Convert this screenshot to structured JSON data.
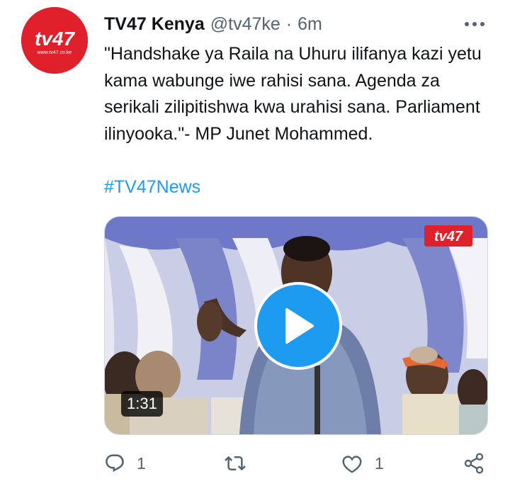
{
  "tweet": {
    "author_name": "TV47 Kenya",
    "handle": "@tv47ke",
    "separator": "·",
    "time": "6m",
    "avatar_logo_text": "tv47",
    "avatar_site_text": "www.tv47.co.ke",
    "text": "\"Handshake ya Raila na Uhuru ilifanya kazi yetu kama wabunge iwe rahisi sana. Agenda za serikali zilipitishwa kwa urahisi sana. Parliament ilinyooka.\"- MP Junet Mohammed.",
    "hashtag": "#TV47News"
  },
  "video": {
    "duration": "1:31",
    "watermark_text": "tv47"
  },
  "actions": {
    "reply_count": "1",
    "retweet_count": "",
    "like_count": "1"
  },
  "icons": [
    "more-icon",
    "reply-icon",
    "retweet-icon",
    "like-icon",
    "share-icon",
    "play-icon"
  ],
  "colors": {
    "brand_red": "#e0202a",
    "accent_blue": "#1d9bf0",
    "secondary_text": "#536471"
  }
}
